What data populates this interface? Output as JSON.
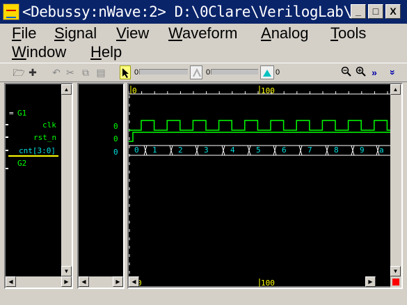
{
  "window": {
    "title": "<Debussy:nWave:2> D:\\0Clare\\VerilogLab\\...",
    "minimize": "_",
    "maximize": "□",
    "close": "X"
  },
  "menu": {
    "row1": [
      {
        "label": "File",
        "accel": "F",
        "rest": "ile"
      },
      {
        "label": "Signal",
        "accel": "S",
        "rest": "ignal"
      },
      {
        "label": "View",
        "accel": "V",
        "rest": "iew"
      },
      {
        "label": "Waveform",
        "accel": "W",
        "rest": "aveform"
      },
      {
        "label": "Analog",
        "accel": "A",
        "rest": "nalog"
      },
      {
        "label": "Tools",
        "accel": "T",
        "rest": "ools"
      }
    ],
    "row2": [
      {
        "label": "Window",
        "accel": "W",
        "rest": "indow"
      },
      {
        "label": "Help",
        "accel": "H",
        "rest": "elp"
      }
    ]
  },
  "toolbar": {
    "cursor_value": "0",
    "marker_value": "0",
    "delta_value": "0"
  },
  "signals": {
    "group1": "G1",
    "group2": "G2",
    "items": [
      {
        "name": "clk",
        "value": "0"
      },
      {
        "name": "rst_n",
        "value": "0"
      },
      {
        "name": "cnt[3:0]",
        "value": "0"
      }
    ]
  },
  "timeline": {
    "top_labels": [
      "0",
      "100"
    ],
    "bottom_labels": [
      "0",
      "100"
    ]
  },
  "cnt_values": [
    "0",
    "1",
    "2",
    "3",
    "4",
    "5",
    "6",
    "7",
    "8",
    "9",
    "a"
  ],
  "colors": {
    "signal_green": "#00ff00",
    "bus_cyan": "#00e0e0",
    "cursor_yellow": "#ffff00",
    "timeline_white": "#ffffff"
  }
}
